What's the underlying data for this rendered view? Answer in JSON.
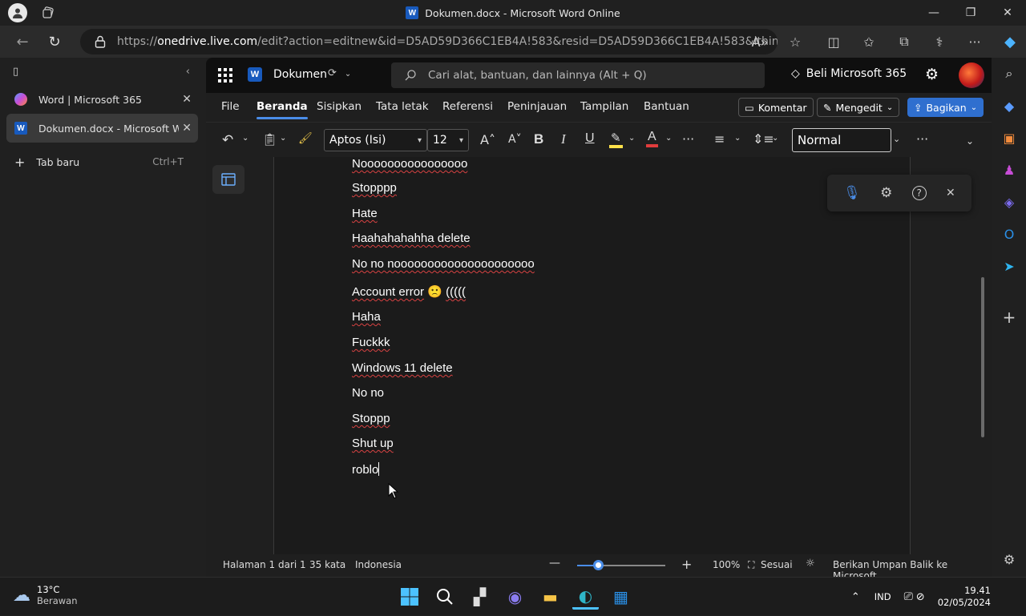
{
  "window": {
    "title": "Dokumen.docx - Microsoft Word Online"
  },
  "browser": {
    "url_prefix": "https://",
    "url_host": "onedrive.live.com",
    "url_rest": "/edit?action=editnew&id=D5AD59D366C1EB4A!583&resid=D5AD59D366C1EB4A!583&ithint=file%..."
  },
  "tabs": [
    {
      "label": "Word | Microsoft 365"
    },
    {
      "label": "Dokumen.docx - Microsoft Word"
    },
    {
      "label": "Tab baru",
      "shortcut": "Ctrl+T"
    }
  ],
  "app": {
    "doc_name": "Dokumen",
    "search_placeholder": "Cari alat, bantuan, dan lainnya (Alt + Q)",
    "buy_label": "Beli Microsoft 365"
  },
  "menu": {
    "items": [
      "File",
      "Beranda",
      "Sisipkan",
      "Tata letak",
      "Referensi",
      "Peninjauan",
      "Tampilan",
      "Bantuan"
    ],
    "comment": "Komentar",
    "editing": "Mengedit",
    "share": "Bagikan"
  },
  "ribbon": {
    "font": "Aptos (Isi)",
    "size": "12",
    "style": "Normal"
  },
  "document": {
    "lines": [
      "Noooooooooooooooo",
      "Stopppp",
      "Hate",
      "Haahahahahha delete",
      "No no nooooooooooooooooooooo",
      "Account error",
      "Haha",
      "Fuckkk",
      "Windows 11 delete",
      "No no",
      "Stoppp",
      "Shut up",
      "roblo"
    ],
    "emoji_suffix": "(((((",
    "emoji": "🙁"
  },
  "status": {
    "page": "Halaman 1 dari 1",
    "words": "35 kata",
    "language": "Indonesia",
    "zoom": "100%",
    "fit": "Sesuai",
    "feedback": "Berikan Umpan Balik ke Microsoft",
    "zoom_level_fraction": 0.24
  },
  "taskbar": {
    "temp": "13°C",
    "weather": "Berawan",
    "lang": "IND",
    "time": "19.41",
    "date": "02/05/2024"
  },
  "colors": {
    "accent": "#2f6fcf",
    "squiggle": "#d94242"
  }
}
